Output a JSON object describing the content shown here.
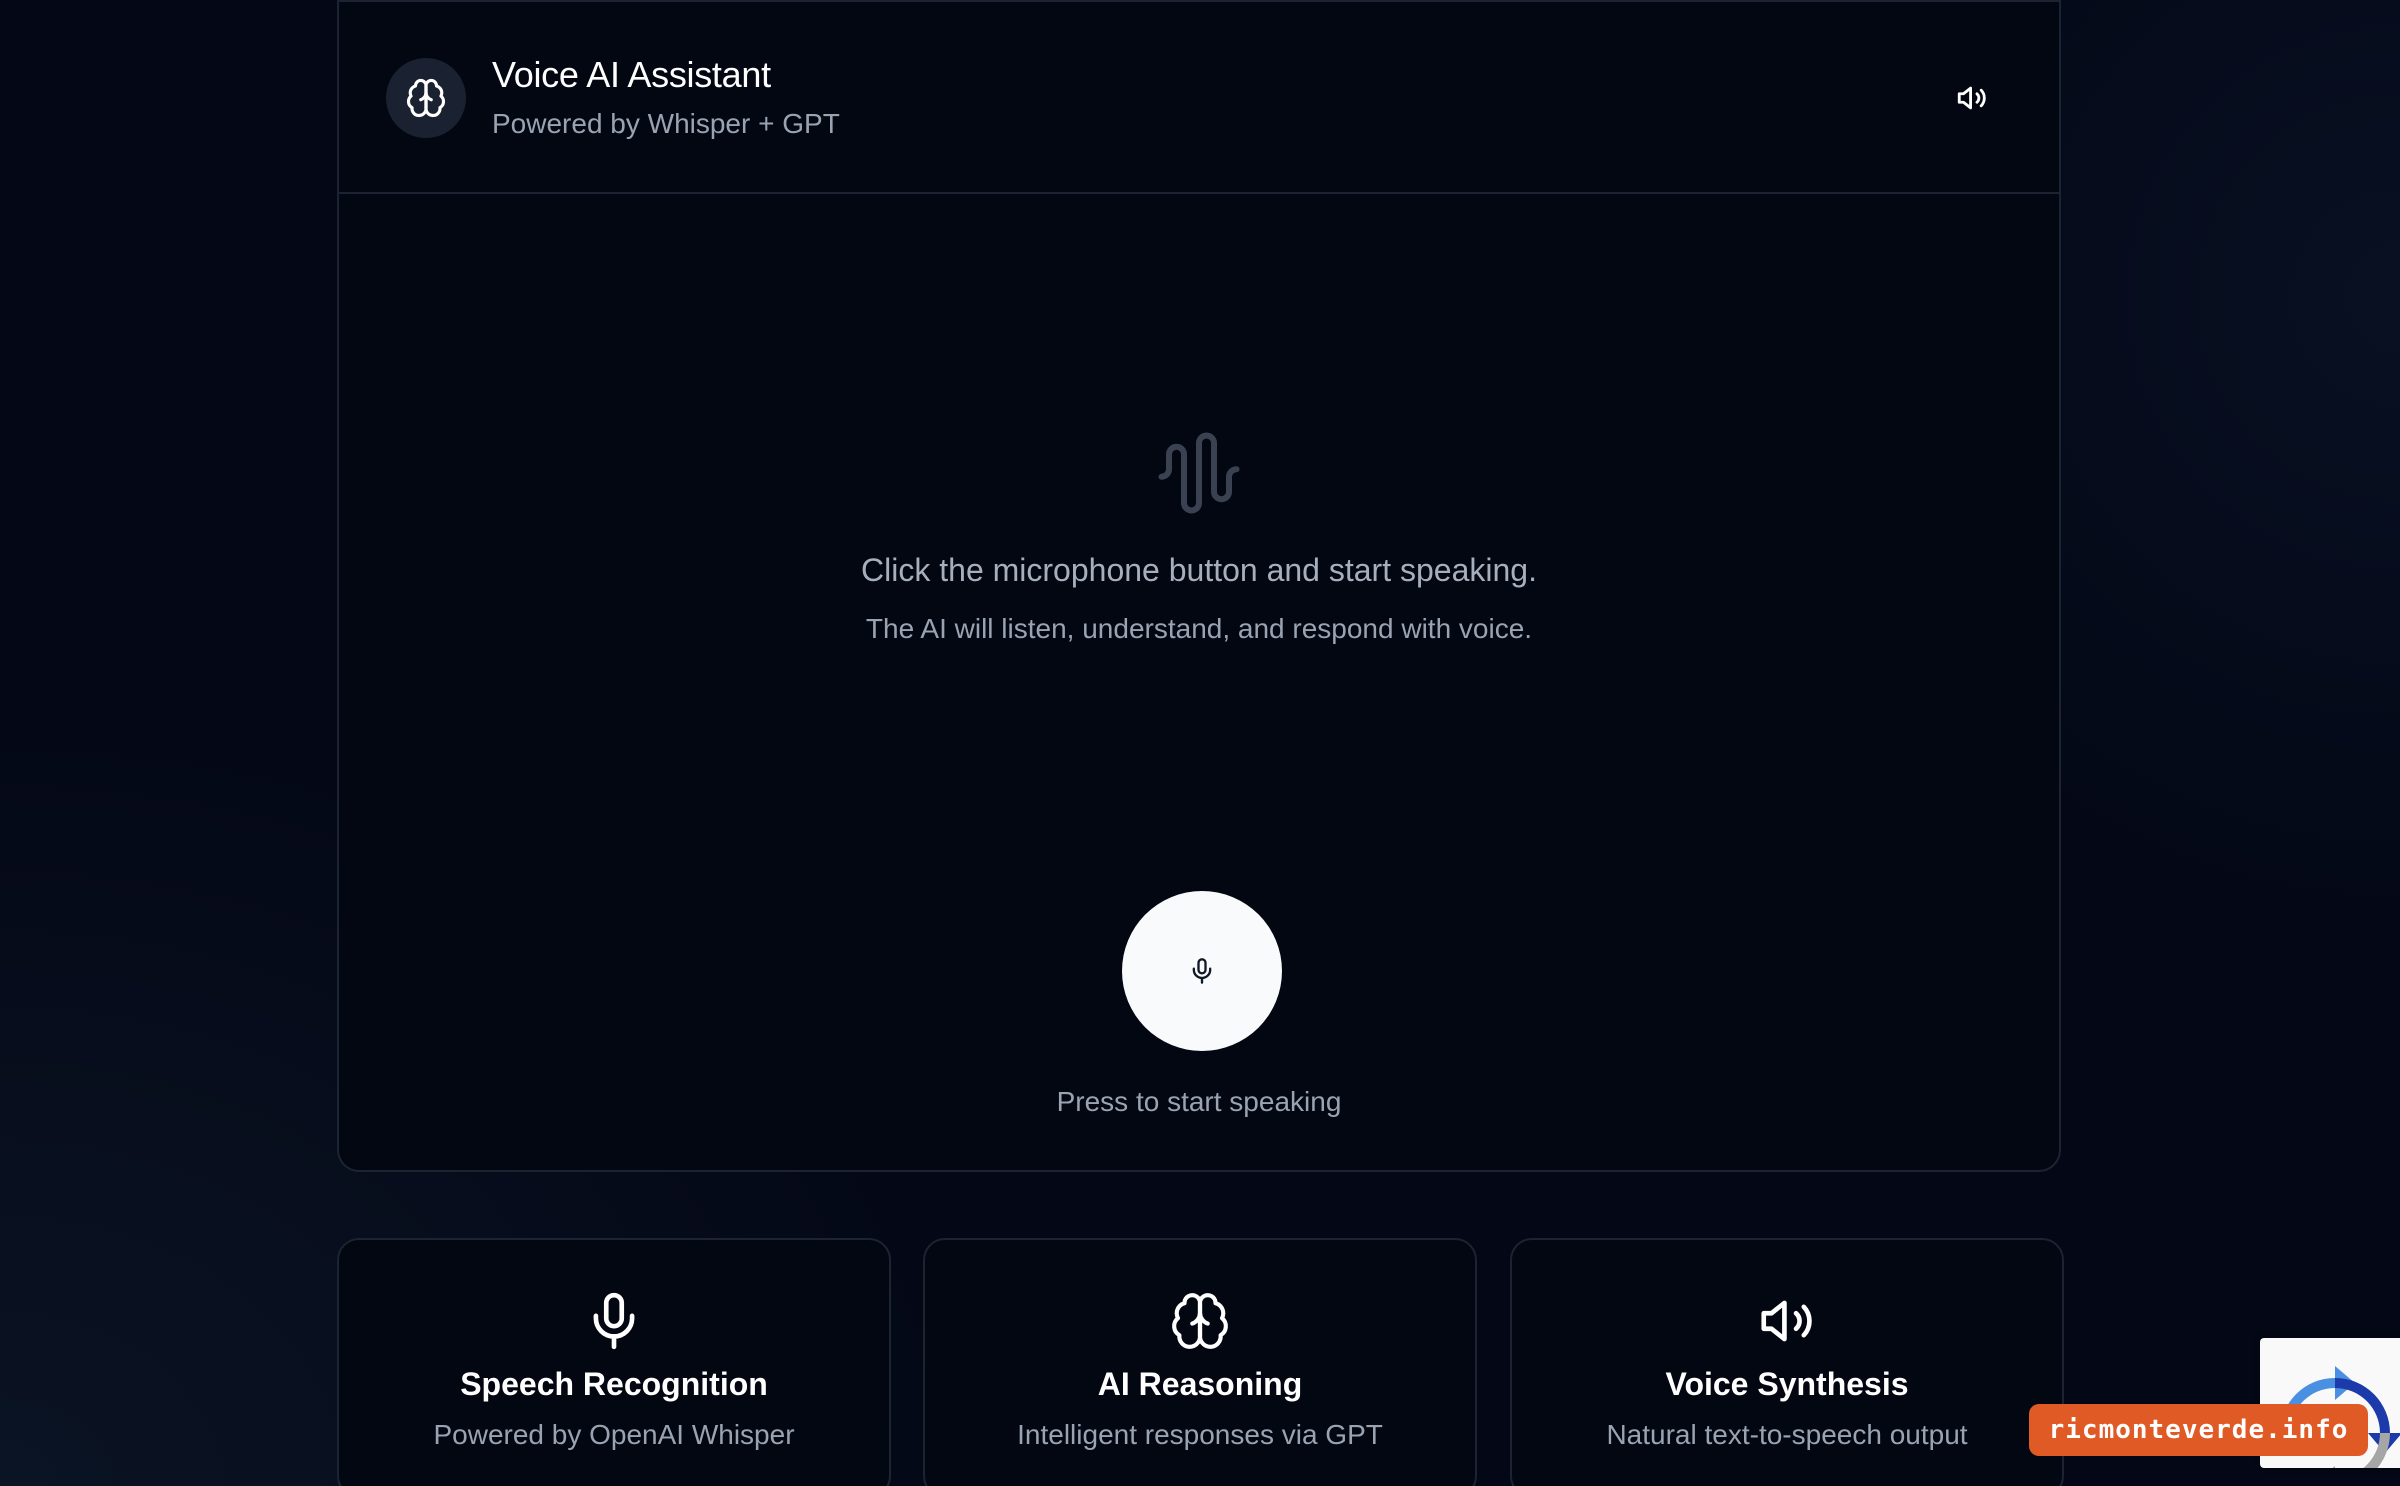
{
  "header": {
    "title": "Voice AI Assistant",
    "subtitle": "Powered by Whisper + GPT",
    "avatar_icon": "brain-icon",
    "speaker_icon": "speaker-icon"
  },
  "empty_state": {
    "icon": "audio-waveform-icon",
    "line1": "Click the microphone button and start speaking.",
    "line2": "The AI will listen, understand, and respond with voice."
  },
  "mic": {
    "icon": "microphone-icon",
    "caption": "Press to start speaking"
  },
  "features": [
    {
      "icon": "microphone-icon",
      "title": "Speech Recognition",
      "description": "Powered by OpenAI Whisper"
    },
    {
      "icon": "brain-icon",
      "title": "AI Reasoning",
      "description": "Intelligent responses via GPT"
    },
    {
      "icon": "speaker-icon",
      "title": "Voice Synthesis",
      "description": "Natural text-to-speech output"
    }
  ],
  "watermark": {
    "text": "ricmonteverde.info"
  },
  "colors": {
    "background": "#040816",
    "card": "#030712",
    "border": "#1c2332",
    "muted_text": "#9aa3b2",
    "mic_button": "#f8fafc",
    "watermark": "#e05a25"
  }
}
